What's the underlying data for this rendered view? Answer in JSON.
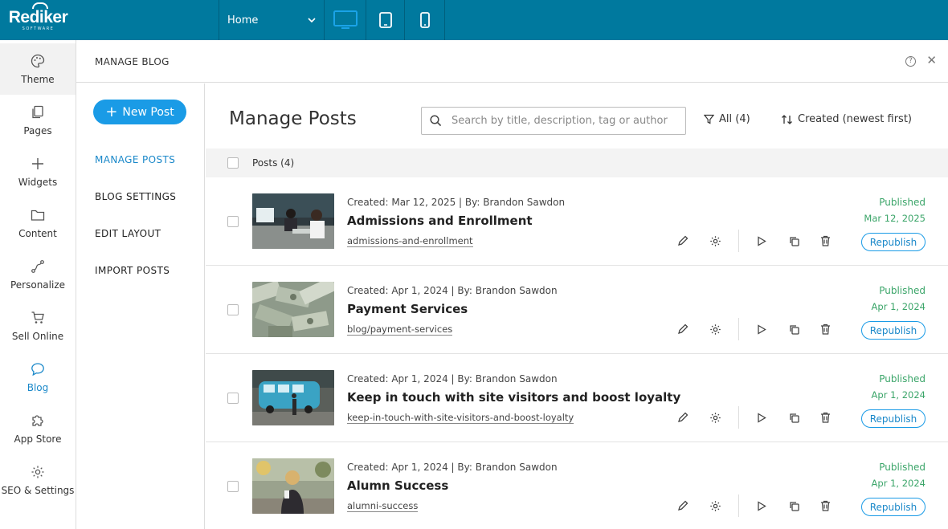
{
  "brand": {
    "name": "Rediker",
    "sub": "SOFTWARE"
  },
  "topbar": {
    "page_select": "Home",
    "devices": [
      "desktop-icon",
      "tablet-icon",
      "mobile-icon"
    ],
    "accent": "#00799e",
    "active_device_color": "#1aa3e8"
  },
  "leftnav": {
    "items": [
      {
        "label": "Theme",
        "icon": "palette-icon"
      },
      {
        "label": "Pages",
        "icon": "pages-icon"
      },
      {
        "label": "Widgets",
        "icon": "plus-icon"
      },
      {
        "label": "Content",
        "icon": "folder-icon"
      },
      {
        "label": "Personalize",
        "icon": "personalize-icon"
      },
      {
        "label": "Sell Online",
        "icon": "cart-icon"
      },
      {
        "label": "Blog",
        "icon": "chat-bubble-icon"
      },
      {
        "label": "App Store",
        "icon": "puzzle-icon"
      },
      {
        "label": "SEO & Settings",
        "icon": "gear-icon"
      }
    ]
  },
  "panel": {
    "title": "MANAGE BLOG",
    "help": "?",
    "close": "✕"
  },
  "subnav": {
    "new_post": "New Post",
    "items": [
      "MANAGE POSTS",
      "BLOG SETTINGS",
      "EDIT LAYOUT",
      "IMPORT POSTS"
    ]
  },
  "main": {
    "title": "Manage Posts",
    "search_placeholder": "Search by title, description, tag or author",
    "filter_label": "All (4)",
    "sort_label": "Created (newest first)",
    "list_header": "Posts (4)"
  },
  "posts": [
    {
      "meta": "Created: Mar 12, 2025 | By: Brandon Sawdon",
      "title": "Admissions and Enrollment",
      "slug": "admissions-and-enrollment",
      "status": "Published",
      "date": "Mar 12, 2025",
      "action": "Republish"
    },
    {
      "meta": "Created: Apr 1, 2024 | By: Brandon Sawdon",
      "title": "Payment Services",
      "slug": "blog/payment-services",
      "status": "Published",
      "date": "Apr 1, 2024",
      "action": "Republish"
    },
    {
      "meta": "Created: Apr 1, 2024 | By: Brandon Sawdon",
      "title": "Keep in touch with site visitors and boost loyalty",
      "slug": "keep-in-touch-with-site-visitors-and-boost-loyalty",
      "status": "Published",
      "date": "Apr 1, 2024",
      "action": "Republish"
    },
    {
      "meta": "Created: Apr 1, 2024 | By: Brandon Sawdon",
      "title": "Alumn Success",
      "slug": "alumni-success",
      "status": "Published",
      "date": "Apr 1, 2024",
      "action": "Republish"
    }
  ]
}
